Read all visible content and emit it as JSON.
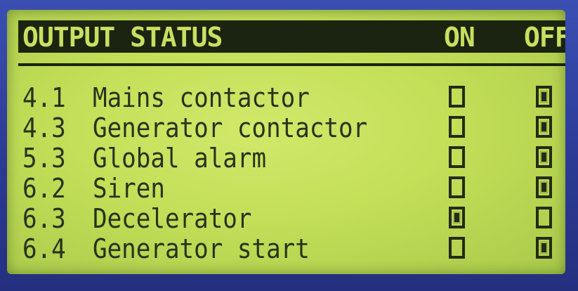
{
  "header": {
    "title": "OUTPUT STATUS",
    "on_label": "ON",
    "off_label": "OFF"
  },
  "outputs": [
    {
      "number": "4.1",
      "label": "Mains contactor",
      "on": false,
      "off": true
    },
    {
      "number": "4.3",
      "label": "Generator contactor",
      "on": false,
      "off": true
    },
    {
      "number": "5.3",
      "label": "Global alarm",
      "on": false,
      "off": true
    },
    {
      "number": "6.2",
      "label": "Siren",
      "on": false,
      "off": true
    },
    {
      "number": "6.3",
      "label": "Decelerator",
      "on": true,
      "off": false
    },
    {
      "number": "6.4",
      "label": "Generator start",
      "on": false,
      "off": true
    }
  ],
  "colors": {
    "bezel": "#2f3f9a",
    "lcd_background": "#c3df58",
    "lcd_ink": "#232c16"
  }
}
